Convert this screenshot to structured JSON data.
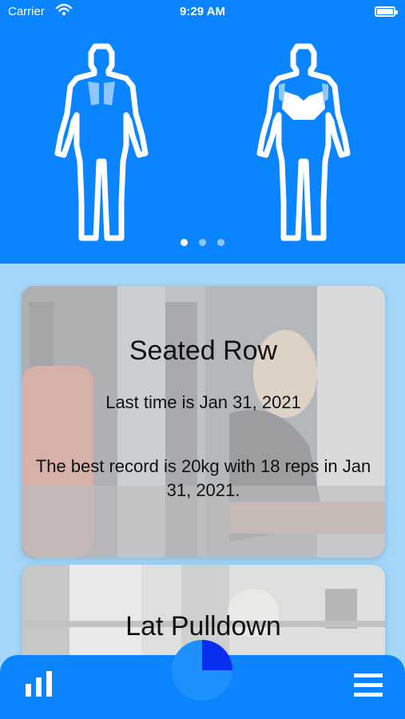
{
  "status_bar": {
    "carrier": "Carrier",
    "time": "9:29 AM"
  },
  "body_map": {
    "page_count": 3,
    "active_page": 0
  },
  "cards": [
    {
      "title": "Seated Row",
      "last_time": "Last time is Jan 31, 2021",
      "best_record": "The best record is 20kg with 18 reps in Jan 31, 2021."
    },
    {
      "title": "Lat Pulldown"
    }
  ],
  "tab_bar": {
    "progress_fraction": 0.25
  },
  "colors": {
    "accent": "#0a84ff",
    "background": "#a3d6f8",
    "muscle_highlight": "#8fc6ff"
  },
  "icons": [
    "wifi-icon",
    "battery-icon",
    "bar-chart-icon",
    "pie-progress-icon",
    "hamburger-menu-icon"
  ]
}
